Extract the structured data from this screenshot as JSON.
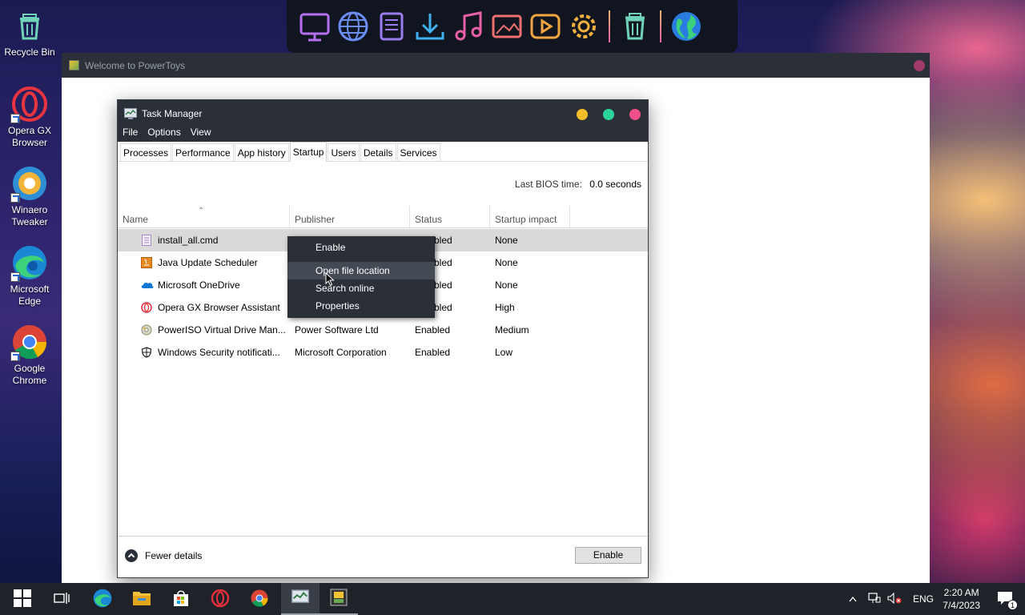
{
  "desktop": {
    "icons": [
      {
        "label": "Recycle Bin",
        "icon": "recycle-bin-icon"
      },
      {
        "label": "Opera GX Browser",
        "icon": "opera-gx-icon"
      },
      {
        "label": "Winaero Tweaker",
        "icon": "winaero-tweaker-icon"
      },
      {
        "label": "Microsoft Edge",
        "icon": "edge-icon"
      },
      {
        "label": "Google Chrome",
        "icon": "chrome-icon"
      }
    ]
  },
  "dock": {
    "items": [
      "monitor-icon",
      "globe-icon",
      "documents-icon",
      "download-icon",
      "music-icon",
      "pictures-icon",
      "video-icon",
      "settings-icon",
      "trash-icon",
      "earth-icon"
    ]
  },
  "powertoys": {
    "title": "Welcome to PowerToys"
  },
  "taskmanager": {
    "title": "Task Manager",
    "menu": [
      "File",
      "Options",
      "View"
    ],
    "tabs": [
      "Processes",
      "Performance",
      "App history",
      "Startup",
      "Users",
      "Details",
      "Services"
    ],
    "active_tab": "Startup",
    "bios_label": "Last BIOS time:",
    "bios_value": "0.0 seconds",
    "columns": [
      "Name",
      "Publisher",
      "Status",
      "Startup impact"
    ],
    "rows": [
      {
        "name": "install_all.cmd",
        "publisher": "",
        "status": "Disabled",
        "impact": "None",
        "icon": "cmd-file-icon"
      },
      {
        "name": "Java Update Scheduler",
        "publisher": "",
        "status": "Disabled",
        "impact": "None",
        "icon": "java-icon"
      },
      {
        "name": "Microsoft OneDrive",
        "publisher": "",
        "status": "Disabled",
        "impact": "None",
        "icon": "onedrive-icon"
      },
      {
        "name": "Opera GX Browser Assistant",
        "publisher": "",
        "status": "Disabled",
        "impact": "High",
        "icon": "opera-icon"
      },
      {
        "name": "PowerISO Virtual Drive Man...",
        "publisher": "Power Software Ltd",
        "status": "Enabled",
        "impact": "Medium",
        "icon": "poweriso-icon"
      },
      {
        "name": "Windows Security notificati...",
        "publisher": "Microsoft Corporation",
        "status": "Enabled",
        "impact": "Low",
        "icon": "shield-icon"
      }
    ],
    "fewer_details": "Fewer details",
    "enable_button": "Enable"
  },
  "context_menu": {
    "items": [
      "Enable",
      "Open file location",
      "Search online",
      "Properties"
    ],
    "hovered": "Open file location"
  },
  "taskbar": {
    "items": [
      "windows-start-icon",
      "task-view-icon",
      "edge-icon",
      "file-explorer-icon",
      "store-icon",
      "opera-icon",
      "chrome-icon",
      "task-manager-icon",
      "powertoys-icon"
    ],
    "language": "ENG",
    "time": "2:20 AM",
    "date": "7/4/2023",
    "notifications": "1"
  }
}
